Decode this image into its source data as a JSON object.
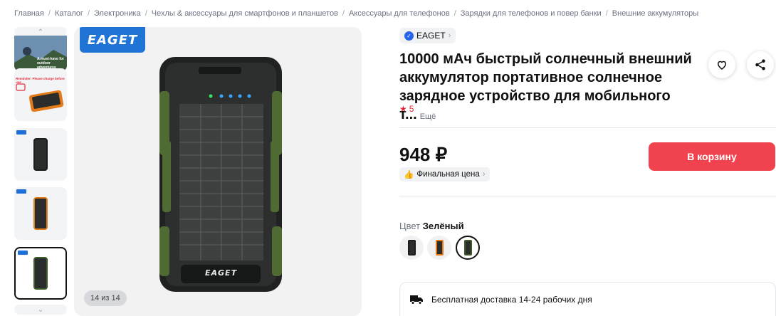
{
  "breadcrumb": [
    "Главная",
    "Каталог",
    "Электроника",
    "Чехлы & аксессуары для смартфонов и планшетов",
    "Аксессуары для телефонов",
    "Зарядки для телефонов и повер банки",
    "Внешние аккумуляторы"
  ],
  "gallery": {
    "brand_logo": "EAGET",
    "device_brand": "EAGET",
    "counter": "14 из 14",
    "thumb1_text": "A must-have for outdoor adventures",
    "thumb2_text": "Reminder: Please charge before use",
    "thumb_icons": [
      "outdoor-photo",
      "reminder-banner",
      "black-bank",
      "orange-bank",
      "green-bank"
    ]
  },
  "product": {
    "brand": "EAGET",
    "title": "10000 мАч быстрый солнечный внешний аккумулятор портативное солнечное зарядное устройство для мобильного т...",
    "more": "Ещё",
    "rating": "5",
    "price": "948 ₽",
    "final_price_label": "Финальная цена",
    "cart_label": "В корзину",
    "color_label": "Цвет",
    "color_value": "Зелёный",
    "colors": [
      "black",
      "orange",
      "green"
    ],
    "delivery_text": "Бесплатная доставка 14-24 рабочих дня"
  },
  "colors": {
    "accent": "#f0434f",
    "brand_blue": "#1f74d6",
    "star": "#e02d3c"
  }
}
